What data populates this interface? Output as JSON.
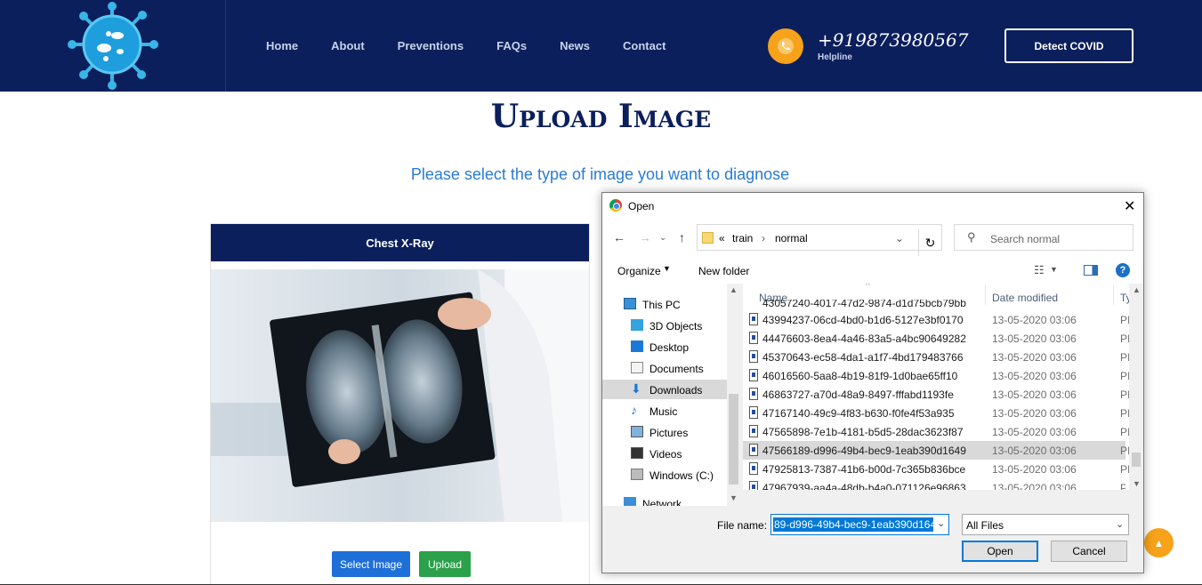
{
  "header": {
    "nav": [
      "Home",
      "About",
      "Preventions",
      "FAQs",
      "News",
      "Contact"
    ],
    "phone": "+919873980567",
    "phone_sub": "Helpline",
    "cta": "Detect COVID"
  },
  "page": {
    "title": "Upload Image",
    "subtitle": "Please select the type of image you want to diagnose"
  },
  "card": {
    "title": "Chest X-Ray",
    "select_label": "Select Image",
    "upload_label": "Upload"
  },
  "colors": {
    "navy": "#0b1f5c",
    "accent": "#f6a21a",
    "blue_btn": "#1f6fd8",
    "green_btn": "#2aa14a"
  },
  "dialog": {
    "title": "Open",
    "path": [
      "«",
      "train",
      "normal"
    ],
    "search_placeholder": "Search normal",
    "organize": "Organize",
    "new_folder": "New folder",
    "tree": [
      {
        "label": "This PC",
        "icon": "pc-icon"
      },
      {
        "label": "3D Objects",
        "icon": "cube-icon"
      },
      {
        "label": "Desktop",
        "icon": "desktop-icon"
      },
      {
        "label": "Documents",
        "icon": "document-icon"
      },
      {
        "label": "Downloads",
        "icon": "download-icon"
      },
      {
        "label": "Music",
        "icon": "music-icon"
      },
      {
        "label": "Pictures",
        "icon": "pictures-icon"
      },
      {
        "label": "Videos",
        "icon": "video-icon"
      },
      {
        "label": "Windows (C:)",
        "icon": "drive-icon"
      },
      {
        "label": "Network",
        "icon": "network-icon"
      }
    ],
    "columns": {
      "name": "Name",
      "date": "Date modified",
      "type": "Ty"
    },
    "files": [
      {
        "name": "43057240-4017-47d2-9874-d1d75bcb79bb",
        "date": "",
        "type": ""
      },
      {
        "name": "43994237-06cd-4bd0-b1d6-5127e3bf0170",
        "date": "13-05-2020 03:06",
        "type": "PI"
      },
      {
        "name": "44476603-8ea4-4a46-83a5-a4bc90649282",
        "date": "13-05-2020 03:06",
        "type": "PI"
      },
      {
        "name": "45370643-ec58-4da1-a1f7-4bd179483766",
        "date": "13-05-2020 03:06",
        "type": "PI"
      },
      {
        "name": "46016560-5aa8-4b19-81f9-1d0bae65ff10",
        "date": "13-05-2020 03:06",
        "type": "PI"
      },
      {
        "name": "46863727-a70d-48a9-8497-fffabd1193fe",
        "date": "13-05-2020 03:06",
        "type": "PI"
      },
      {
        "name": "47167140-49c9-4f83-b630-f0fe4f53a935",
        "date": "13-05-2020 03:06",
        "type": "PI"
      },
      {
        "name": "47565898-7e1b-4181-b5d5-28dac3623f87",
        "date": "13-05-2020 03:06",
        "type": "PI"
      },
      {
        "name": "47566189-d996-49b4-bec9-1eab390d1649",
        "date": "13-05-2020 03:06",
        "type": "PI"
      },
      {
        "name": "47925813-7387-41b6-b00d-7c365b836bce",
        "date": "13-05-2020 03:06",
        "type": "PI"
      },
      {
        "name": "47967939-aa4a-48db-b4a0-071126e96863",
        "date": "13-05-2020 03:06",
        "type": "PI"
      }
    ],
    "filename_label": "File name:",
    "filename_value": "89-d996-49b4-bec9-1eab390d1649",
    "filter": "All Files",
    "open_label": "Open",
    "cancel_label": "Cancel"
  }
}
